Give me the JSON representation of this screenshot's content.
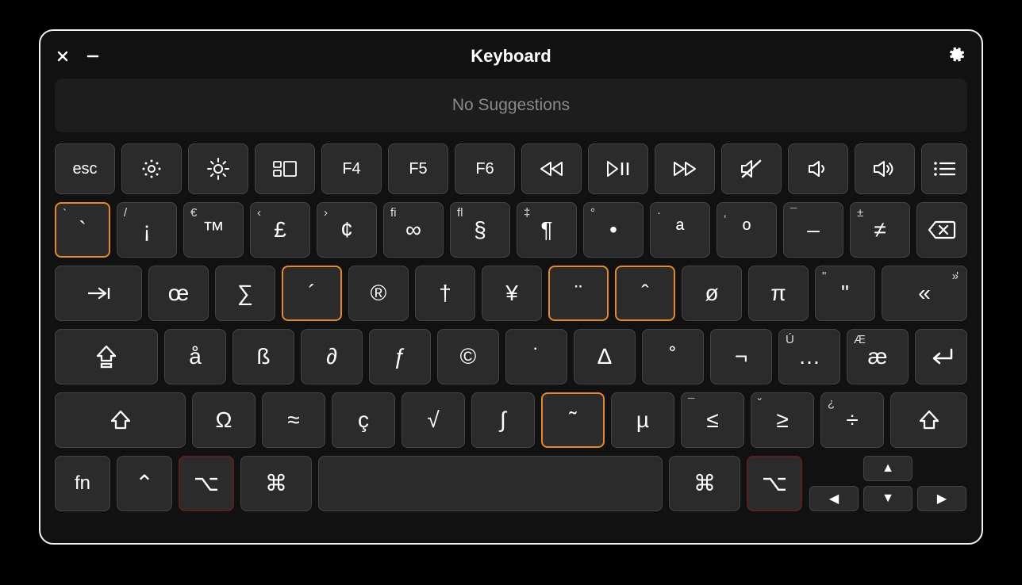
{
  "window": {
    "title": "Keyboard"
  },
  "suggestions": {
    "text": "No Suggestions"
  },
  "fnRow": {
    "esc": "esc",
    "f4": "F4",
    "f5": "F5",
    "f6": "F6"
  },
  "row1": {
    "k0": {
      "sup": "`",
      "main": "`"
    },
    "k1": {
      "sup": "/",
      "main": "¡"
    },
    "k2": {
      "sup": "€",
      "main": "™"
    },
    "k3": {
      "sup": "‹",
      "main": "£"
    },
    "k4": {
      "sup": "›",
      "main": "¢"
    },
    "k5": {
      "sup": "ﬁ",
      "main": "∞"
    },
    "k6": {
      "sup": "ﬂ",
      "main": "§"
    },
    "k7": {
      "sup": "‡",
      "main": "¶"
    },
    "k8": {
      "sup": "°",
      "main": "•"
    },
    "k9": {
      "sup": "·",
      "main": "ª"
    },
    "k10": {
      "sup": "‚",
      "main": "º"
    },
    "k11": {
      "sup": "¯",
      "main": "–"
    },
    "k12": {
      "sup": "±",
      "main": "≠"
    }
  },
  "row2": {
    "k0": {
      "main": "œ"
    },
    "k1": {
      "main": "∑"
    },
    "k2": {
      "main": "´"
    },
    "k3": {
      "main": "®"
    },
    "k4": {
      "main": "†"
    },
    "k5": {
      "main": "¥"
    },
    "k6": {
      "main": "¨"
    },
    "k7": {
      "main": "ˆ"
    },
    "k8": {
      "main": "ø"
    },
    "k9": {
      "main": "π"
    },
    "k10": {
      "sup": "\"",
      "main": "\""
    },
    "k11": {
      "sup": "'",
      "main": "«"
    }
  },
  "row3": {
    "k0": {
      "main": "å"
    },
    "k1": {
      "main": "ß"
    },
    "k2": {
      "main": "∂"
    },
    "k3": {
      "main": "ƒ"
    },
    "k4": {
      "main": "©"
    },
    "k5": {
      "main": "˙"
    },
    "k6": {
      "main": "∆"
    },
    "k7": {
      "main": "˚"
    },
    "k8": {
      "main": "¬"
    },
    "k9": {
      "sup": "Ú",
      "main": "…"
    },
    "k10": {
      "sup": "Æ",
      "main": "æ"
    }
  },
  "row4": {
    "k0": {
      "main": "Ω"
    },
    "k1": {
      "main": "≈"
    },
    "k2": {
      "main": "ç"
    },
    "k3": {
      "main": "√"
    },
    "k4": {
      "main": "∫"
    },
    "k5": {
      "main": "˜"
    },
    "k6": {
      "main": "µ"
    },
    "k7": {
      "sup": "¯",
      "main": "≤"
    },
    "k8": {
      "sup": "˘",
      "main": "≥"
    },
    "k9": {
      "sup": "¿",
      "main": "÷"
    }
  },
  "row5": {
    "fn": "fn",
    "ctrl": "⌃",
    "opt": "⌥",
    "cmd": "⌘"
  },
  "arrows": {
    "up": "▲",
    "down": "▼",
    "left": "◀",
    "right": "▶"
  }
}
